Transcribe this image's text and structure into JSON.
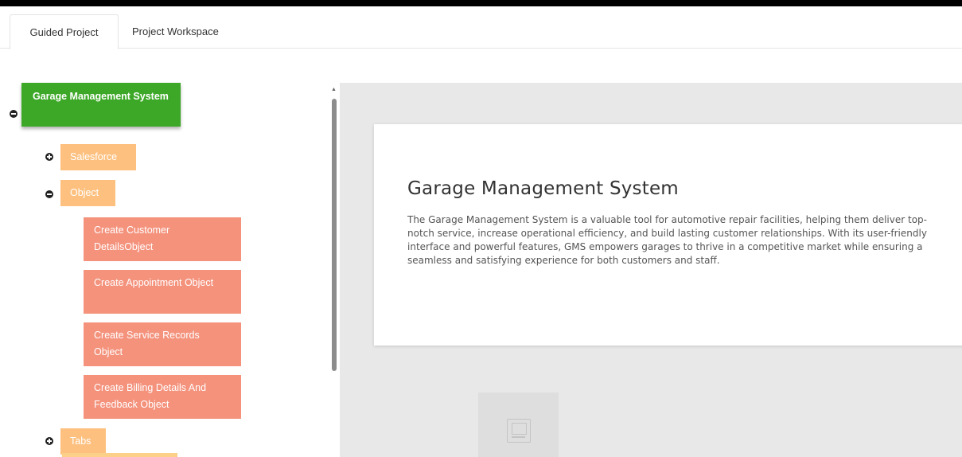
{
  "tabs": [
    {
      "label": "Guided Project"
    },
    {
      "label": "Project Workspace"
    }
  ],
  "tree": {
    "root": {
      "label": "Garage Management System"
    },
    "salesforce": {
      "label": "Salesforce"
    },
    "object": {
      "label": "Object"
    },
    "object_children": [
      {
        "label": "Create Customer DetailsObject"
      },
      {
        "label": "Create Appointment Object"
      },
      {
        "label": "Create Service Records Object"
      },
      {
        "label": "Create Billing Details And Feedback Object"
      }
    ],
    "tabs_node": {
      "label": "Tabs"
    }
  },
  "main": {
    "title": "Garage Management System",
    "description": "The Garage Management System is a valuable tool for automotive repair facilities, helping them deliver top-notch service, increase operational efficiency, and build lasting customer relationships. With its user-friendly interface and powerful features, GMS empowers garages to thrive in a competitive market while ensuring a seamless and satisfying experience for both customers and staff."
  },
  "colors": {
    "root_node": "#3da827",
    "category_node": "#fdc07f",
    "task_node": "#f4927c",
    "content_bg": "#e8e8e8"
  },
  "icons": {
    "collapse": "minus-circle-icon",
    "expand": "plus-circle-icon",
    "document": "document-icon",
    "scroll_up": "scroll-up-arrow-icon"
  }
}
